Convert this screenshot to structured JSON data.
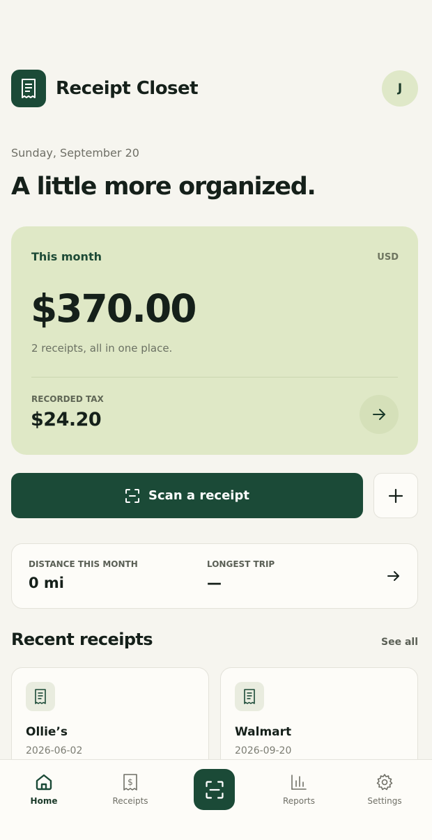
{
  "app": {
    "title": "Receipt Closet",
    "avatar_initial": "J"
  },
  "date": "Sunday, September 20",
  "headline": "A little more organized.",
  "summary": {
    "period_label": "This month",
    "currency": "USD",
    "total": "$370.00",
    "subtitle": "2 receipts, all in one place.",
    "tax_label": "RECORDED TAX",
    "tax_value": "$24.20"
  },
  "actions": {
    "scan_label": "Scan a receipt"
  },
  "mileage": {
    "distance_label": "DISTANCE THIS MONTH",
    "distance_value": "0 mi",
    "longest_label": "LONGEST TRIP",
    "longest_value": "—"
  },
  "recent": {
    "title": "Recent receipts",
    "see_all": "See all",
    "items": [
      {
        "merchant": "Ollie’s",
        "date": "2026-06-02"
      },
      {
        "merchant": "Walmart",
        "date": "2026-09-20"
      }
    ]
  },
  "nav": {
    "items": [
      {
        "label": "Home",
        "icon": "home-icon",
        "active": true
      },
      {
        "label": "Receipts",
        "icon": "receipt-dollar-icon",
        "active": false
      },
      {
        "label": "",
        "icon": "scan-icon",
        "active": false
      },
      {
        "label": "Reports",
        "icon": "bar-chart-icon",
        "active": false
      },
      {
        "label": "Settings",
        "icon": "gear-icon",
        "active": false
      }
    ]
  },
  "colors": {
    "primary": "#1b4a37",
    "summary_bg": "#dfe8c6",
    "background": "#f6f5ef",
    "card_bg": "#fdfcf8",
    "avatar_bg": "#dfe8c8"
  }
}
